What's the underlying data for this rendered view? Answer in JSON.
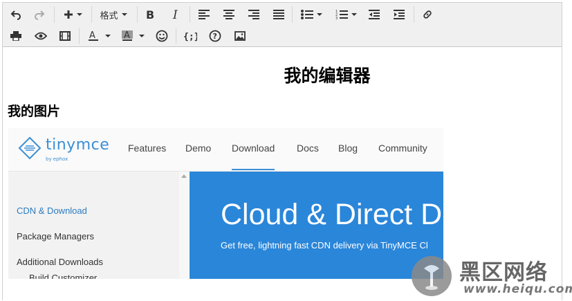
{
  "toolbar": {
    "format_label": "格式"
  },
  "content": {
    "heading": "我的编辑器",
    "subheading": "我的图片"
  },
  "image": {
    "logo_text": "tinymce",
    "logo_sub": "by ephox",
    "nav": [
      "Features",
      "Demo",
      "Download",
      "Docs",
      "Blog",
      "Community"
    ],
    "sidebar": [
      "CDN & Download",
      "Package Managers",
      "Additional Downloads",
      "Build Customizer"
    ],
    "hero_title": "Cloud & Direct D",
    "hero_subtitle": "Get free, lightning fast CDN delivery via TinyMCE Cl"
  },
  "watermark": {
    "brand": "黑区网络",
    "url": "www.heiqu.com"
  },
  "colors": {
    "accent": "#2a86d9",
    "toolbar_bg": "#f0f0f0"
  }
}
